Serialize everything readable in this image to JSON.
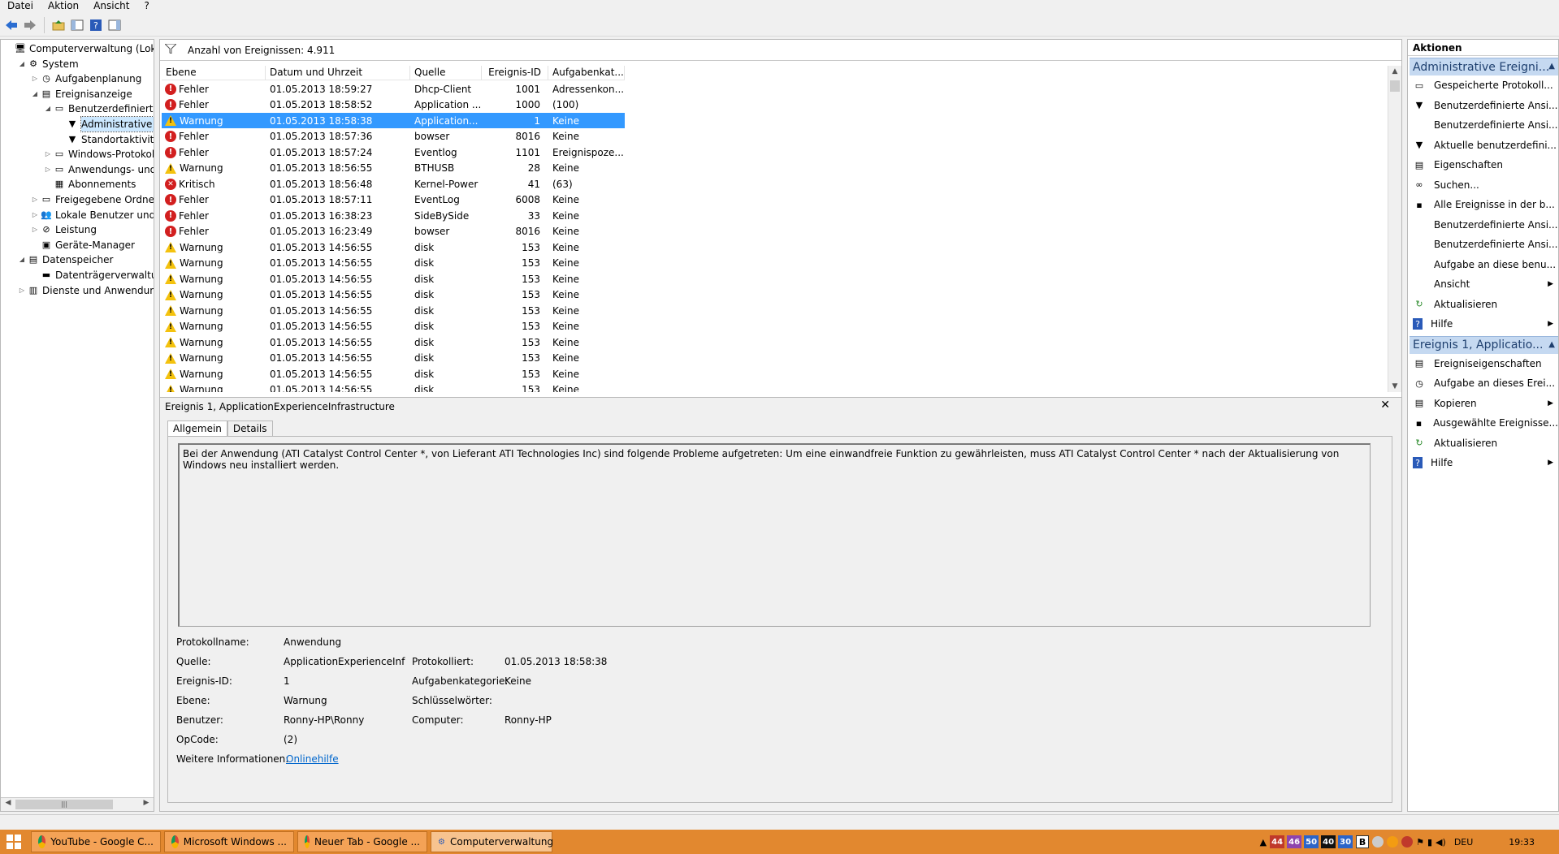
{
  "menu": [
    "Datei",
    "Aktion",
    "Ansicht",
    "?"
  ],
  "tree": {
    "items": [
      {
        "label": "Computerverwaltung (Lokal)",
        "depth": 0,
        "arrow": "",
        "icon": "computer-icon"
      },
      {
        "label": "System",
        "depth": 1,
        "arrow": "◢",
        "icon": "tools-icon"
      },
      {
        "label": "Aufgabenplanung",
        "depth": 2,
        "arrow": "▷",
        "icon": "clock-icon"
      },
      {
        "label": "Ereignisanzeige",
        "depth": 2,
        "arrow": "◢",
        "icon": "event-viewer-icon"
      },
      {
        "label": "Benutzerdefinierte A",
        "depth": 3,
        "arrow": "◢",
        "icon": "folder-icon"
      },
      {
        "label": "Administrative E",
        "depth": 4,
        "arrow": "",
        "icon": "filter-icon",
        "selected": true
      },
      {
        "label": "Standortaktivität",
        "depth": 4,
        "arrow": "",
        "icon": "filter-icon"
      },
      {
        "label": "Windows-Protokolle",
        "depth": 3,
        "arrow": "▷",
        "icon": "folder-icon"
      },
      {
        "label": "Anwendungs- und D",
        "depth": 3,
        "arrow": "▷",
        "icon": "folder-icon"
      },
      {
        "label": "Abonnements",
        "depth": 3,
        "arrow": "",
        "icon": "subscription-icon"
      },
      {
        "label": "Freigegebene Ordner",
        "depth": 2,
        "arrow": "▷",
        "icon": "shared-folder-icon"
      },
      {
        "label": "Lokale Benutzer und Gru",
        "depth": 2,
        "arrow": "▷",
        "icon": "users-icon"
      },
      {
        "label": "Leistung",
        "depth": 2,
        "arrow": "▷",
        "icon": "performance-icon"
      },
      {
        "label": "Geräte-Manager",
        "depth": 2,
        "arrow": "",
        "icon": "device-manager-icon"
      },
      {
        "label": "Datenspeicher",
        "depth": 1,
        "arrow": "◢",
        "icon": "storage-icon"
      },
      {
        "label": "Datenträgerverwaltung",
        "depth": 2,
        "arrow": "",
        "icon": "disk-icon"
      },
      {
        "label": "Dienste und Anwendungen",
        "depth": 1,
        "arrow": "▷",
        "icon": "services-icon"
      }
    ]
  },
  "list": {
    "header": "Anzahl von Ereignissen: 4.911",
    "columns": [
      "Ebene",
      "Datum und Uhrzeit",
      "Quelle",
      "Ereignis-ID",
      "Aufgabenkat..."
    ],
    "rows": [
      {
        "level": "Fehler",
        "kind": "err",
        "date": "01.05.2013 18:59:27",
        "source": "Dhcp-Client",
        "id": "1001",
        "task": "Adressenkon..."
      },
      {
        "level": "Fehler",
        "kind": "err",
        "date": "01.05.2013 18:58:52",
        "source": "Application ...",
        "id": "1000",
        "task": "(100)"
      },
      {
        "level": "Warnung",
        "kind": "warn",
        "date": "01.05.2013 18:58:38",
        "source": "Application...",
        "id": "1",
        "task": "Keine",
        "selected": true
      },
      {
        "level": "Fehler",
        "kind": "err",
        "date": "01.05.2013 18:57:36",
        "source": "bowser",
        "id": "8016",
        "task": "Keine"
      },
      {
        "level": "Fehler",
        "kind": "err",
        "date": "01.05.2013 18:57:24",
        "source": "Eventlog",
        "id": "1101",
        "task": "Ereignispoze..."
      },
      {
        "level": "Warnung",
        "kind": "warn",
        "date": "01.05.2013 18:56:55",
        "source": "BTHUSB",
        "id": "28",
        "task": "Keine"
      },
      {
        "level": "Kritisch",
        "kind": "crit",
        "date": "01.05.2013 18:56:48",
        "source": "Kernel-Power",
        "id": "41",
        "task": "(63)"
      },
      {
        "level": "Fehler",
        "kind": "err",
        "date": "01.05.2013 18:57:11",
        "source": "EventLog",
        "id": "6008",
        "task": "Keine"
      },
      {
        "level": "Fehler",
        "kind": "err",
        "date": "01.05.2013 16:38:23",
        "source": "SideBySide",
        "id": "33",
        "task": "Keine"
      },
      {
        "level": "Fehler",
        "kind": "err",
        "date": "01.05.2013 16:23:49",
        "source": "bowser",
        "id": "8016",
        "task": "Keine"
      },
      {
        "level": "Warnung",
        "kind": "warn",
        "date": "01.05.2013 14:56:55",
        "source": "disk",
        "id": "153",
        "task": "Keine"
      },
      {
        "level": "Warnung",
        "kind": "warn",
        "date": "01.05.2013 14:56:55",
        "source": "disk",
        "id": "153",
        "task": "Keine"
      },
      {
        "level": "Warnung",
        "kind": "warn",
        "date": "01.05.2013 14:56:55",
        "source": "disk",
        "id": "153",
        "task": "Keine"
      },
      {
        "level": "Warnung",
        "kind": "warn",
        "date": "01.05.2013 14:56:55",
        "source": "disk",
        "id": "153",
        "task": "Keine"
      },
      {
        "level": "Warnung",
        "kind": "warn",
        "date": "01.05.2013 14:56:55",
        "source": "disk",
        "id": "153",
        "task": "Keine"
      },
      {
        "level": "Warnung",
        "kind": "warn",
        "date": "01.05.2013 14:56:55",
        "source": "disk",
        "id": "153",
        "task": "Keine"
      },
      {
        "level": "Warnung",
        "kind": "warn",
        "date": "01.05.2013 14:56:55",
        "source": "disk",
        "id": "153",
        "task": "Keine"
      },
      {
        "level": "Warnung",
        "kind": "warn",
        "date": "01.05.2013 14:56:55",
        "source": "disk",
        "id": "153",
        "task": "Keine"
      },
      {
        "level": "Warnung",
        "kind": "warn",
        "date": "01.05.2013 14:56:55",
        "source": "disk",
        "id": "153",
        "task": "Keine"
      },
      {
        "level": "Warnung",
        "kind": "warn",
        "date": "01.05.2013 14:56:55",
        "source": "disk",
        "id": "153",
        "task": "Keine"
      }
    ]
  },
  "detail": {
    "title": "Ereignis 1, ApplicationExperienceInfrastructure",
    "close": "✕",
    "tabs": [
      "Allgemein",
      "Details"
    ],
    "message": "Bei der Anwendung (ATI Catalyst Control Center *, von Lieferant ATI Technologies Inc) sind folgende Probleme aufgetreten: Um eine einwandfreie Funktion zu gewährleisten, muss ATI Catalyst Control Center * nach der Aktualisierung von Windows neu installiert werden.",
    "props": {
      "protokollname_label": "Protokollname:",
      "protokollname": "Anwendung",
      "quelle_label": "Quelle:",
      "quelle": "ApplicationExperienceInfrast",
      "protokolliert_label": "Protokolliert:",
      "protokolliert": "01.05.2013 18:58:38",
      "ereignisid_label": "Ereignis-ID:",
      "ereignisid": "1",
      "aufgabenkat_label": "Aufgabenkategorie:",
      "aufgabenkat": "Keine",
      "ebene_label": "Ebene:",
      "ebene": "Warnung",
      "schluessel_label": "Schlüsselwörter:",
      "benutzer_label": "Benutzer:",
      "benutzer": "Ronny-HP\\Ronny",
      "computer_label": "Computer:",
      "computer": "Ronny-HP",
      "opcode_label": "OpCode:",
      "opcode": "(2)",
      "weitere_label": "Weitere Informationen:",
      "weitere_link": "Onlinehilfe"
    }
  },
  "actions": {
    "header": "Aktionen",
    "section1": "Administrative Ereigni...",
    "items1": [
      {
        "label": "Gespeicherte Protokoll...",
        "icon": "open-folder-icon",
        "sub": false
      },
      {
        "label": "Benutzerdefinierte Ansi...",
        "icon": "create-view-icon",
        "sub": false
      },
      {
        "label": "Benutzerdefinierte Ansi...",
        "icon": "",
        "sub": false
      },
      {
        "label": "Aktuelle benutzerdefini...",
        "icon": "filter-icon",
        "sub": false
      },
      {
        "label": "Eigenschaften",
        "icon": "properties-icon",
        "sub": false
      },
      {
        "label": "Suchen...",
        "icon": "binoculars-icon",
        "sub": false
      },
      {
        "label": "Alle Ereignisse in der b...",
        "icon": "save-icon",
        "sub": false
      },
      {
        "label": "Benutzerdefinierte Ansi...",
        "icon": "",
        "sub": false
      },
      {
        "label": "Benutzerdefinierte Ansi...",
        "icon": "",
        "sub": false
      },
      {
        "label": "Aufgabe an diese benu...",
        "icon": "",
        "sub": false
      },
      {
        "label": "Ansicht",
        "icon": "",
        "sub": true
      },
      {
        "label": "Aktualisieren",
        "icon": "refresh-icon",
        "sub": false
      },
      {
        "label": "Hilfe",
        "icon": "help-icon",
        "sub": true
      }
    ],
    "section2": "Ereignis 1, Applicatio...",
    "items2": [
      {
        "label": "Ereigniseigenschaften",
        "icon": "properties-icon",
        "sub": false
      },
      {
        "label": "Aufgabe an dieses Erei...",
        "icon": "task-icon",
        "sub": false
      },
      {
        "label": "Kopieren",
        "icon": "copy-icon",
        "sub": true
      },
      {
        "label": "Ausgewählte Ereignisse...",
        "icon": "save-icon",
        "sub": false
      },
      {
        "label": "Aktualisieren",
        "icon": "refresh-icon",
        "sub": false
      },
      {
        "label": "Hilfe",
        "icon": "help-icon",
        "sub": true
      }
    ]
  },
  "taskbar": {
    "apps": [
      {
        "label": "YouTube - Google C...",
        "icon": "chrome-icon",
        "active": false
      },
      {
        "label": "Microsoft Windows ...",
        "icon": "chrome-icon",
        "active": false
      },
      {
        "label": "Neuer Tab - Google ...",
        "icon": "chrome-icon",
        "active": false
      },
      {
        "label": "Computerverwaltung",
        "icon": "computer-management-icon",
        "active": true
      }
    ],
    "tray_numbers": [
      {
        "value": "44",
        "color": "#c0392b"
      },
      {
        "value": "46",
        "color": "#8e44ad"
      },
      {
        "value": "50",
        "color": "#2c64c8"
      },
      {
        "value": "40",
        "color": "#111111"
      },
      {
        "value": "30",
        "color": "#2c64c8"
      }
    ],
    "language": "DEU",
    "time": "19:33"
  }
}
